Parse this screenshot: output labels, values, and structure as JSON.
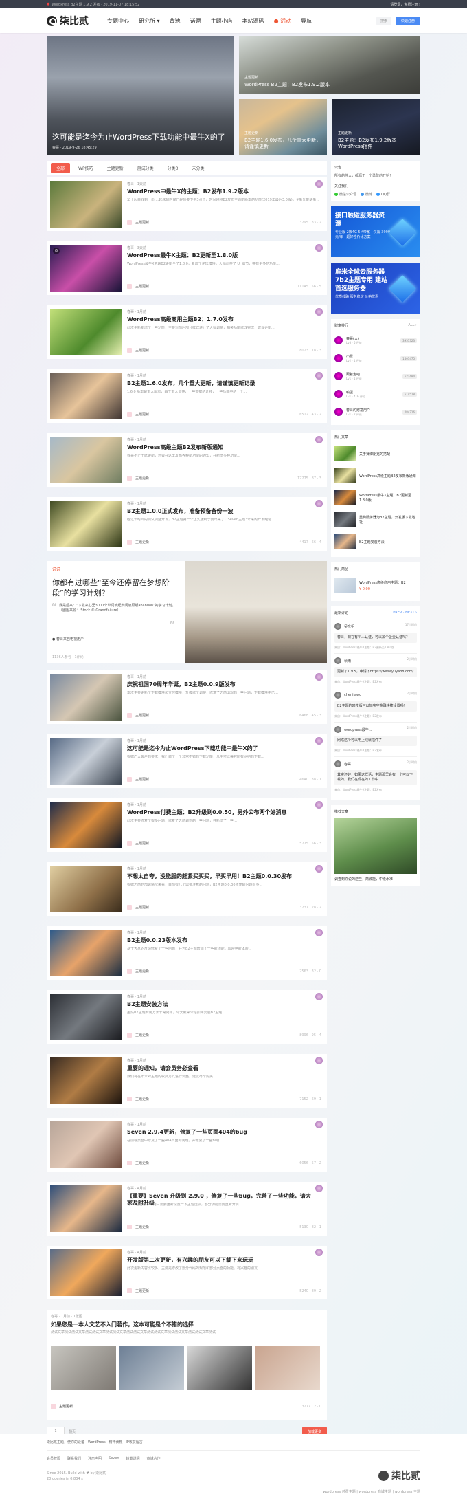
{
  "topbar": {
    "left": "WordPress B2主题 1.9.2 发布 · 2019-11-07 18:15:52",
    "right": "请登录，免费注册 ›"
  },
  "nav": {
    "logo": "柒比贰",
    "menu": [
      "专题中心",
      "研究所 ▾",
      "背池",
      "话题",
      "主题小店",
      "本站源码",
      "● 活动",
      "导航"
    ],
    "search": "搜索",
    "register": "快速注册"
  },
  "hero": {
    "big": {
      "tag": "● 未分类",
      "title": "这可能是迄今为止WordPress下载功能中最牛X的了",
      "meta": "春哥 · 2019-9-26 18:45:29"
    },
    "b1": {
      "tag": "主题更新",
      "title": "WordPress B2主题：B2发布1.9.2版本"
    },
    "b2": {
      "tag": "主题更新",
      "title": "B2主题1.6.0发布，几个重大更新，请谨慎更新"
    },
    "b3": {
      "tag": "主题更新",
      "title": "B2主题：B2发布1.9.2版本 WordPress插件"
    }
  },
  "tabs": [
    "全部",
    "WP技巧",
    "主题更新",
    "测试分类",
    "分类3",
    "未分类"
  ],
  "posts": [
    {
      "meta": "春哥 · 1天前",
      "title": "WordPress中最牛X的主题：B2发布1.9.2版本",
      "ex": "早上起来收到一份....起床的时候已经快要下午3点了，时间刚刚B2发布主题新版本的功能(2019年最后3.0版)，全新功能更新...",
      "cat": "主题更新",
      "stats": "3295 · 33 · 2"
    },
    {
      "meta": "春哥 · 3天前",
      "title": "WordPress最牛X主题：B2更新至1.8.0版",
      "ex": "WordPress最牛X主题B2更新至了1.8.0，新增了论坛模块，大幅调整了 UI 细节，拥有更多的功能...",
      "cat": "主题更新",
      "stats": "11145 · 56 · 5"
    },
    {
      "meta": "春哥 · 1月前",
      "title": "WordPress高级商用主题B2：1.7.0发布",
      "ex": "此次更新新增了一些功能，主要对前后部分样式进行了大幅调整，相关功能修改完成，建议更新...",
      "cat": "主题更新",
      "stats": "8023 · 78 · 3"
    },
    {
      "meta": "春哥 · 1月前",
      "title": "B2主题1.6.0发布，几个重大更新，请谨慎更新记录",
      "ex": "1.6.0 版本是重大版本，由于重大调整，一些数据的迁移，一些功能中的一个...",
      "cat": "主题更新",
      "stats": "6512 · 43 · 2"
    },
    {
      "meta": "春哥 · 1月前",
      "title": "WordPress高级主题B2发布新版通知",
      "ex": "春哥不止于此更新，还会在这里发布各种新功能的通知，并新增多种功能...",
      "cat": "主题更新",
      "stats": "12275 · 87 · 3"
    },
    {
      "meta": "春哥 · 1月前",
      "title": "B2主题1.0.0正式发布，准备预备备份一波",
      "ex": "经过长时间的测试调整开发，B2主题第一个正式版终于要出来了，Seven主题3年来的开发经验...",
      "cat": "主题更新",
      "stats": "4417 · 66 · 4"
    }
  ],
  "quote": {
    "label": "说说",
    "q": "你都有过哪些“至今还停留在梦想阶段”的学习计划？",
    "body": "我是后来：“下载来心里3000个单词就起步阅读原版abandon”的学习计划。（图图来源：iStock © Grandfailure）",
    "author": "● 春哥来自电视用户",
    "ft": "1136人参与 · 1评论"
  },
  "posts2": [
    {
      "meta": "春哥 · 1月前",
      "title": "庆祝祖国70周年华诞，B2主题0.0.9版发布",
      "ex": "本次主要更新了下载模块和支付模块，升级修了调整，修复了之前出现的一些问题，下载模块中已…",
      "cat": "主题更新",
      "stats": "6468 · 45 · 3"
    },
    {
      "meta": "春哥 · 1月前",
      "title": "这可能是迄今为止WordPress下载功能中最牛X的了",
      "ex": "根据广大客户的要求，我们做了一个非常不错的下载功能，几乎可以兼容所有网络的下载...",
      "cat": "主题更新",
      "stats": "4640 · 38 · 1"
    },
    {
      "meta": "春哥 · 1月前",
      "title": "WordPress付费主题：B2升级到0.0.50，另外公布两个好消息",
      "ex": "此次主要修复了很多问题，修复了之前遇到的一些问题，并新增了一些…",
      "cat": "主题更新",
      "stats": "5775 · 56 · 3"
    },
    {
      "meta": "春哥 · 1月前",
      "title": "不想太自夸，没能服的赶紧买买买，早买早用！B2主题0.0.30发布",
      "ex": "根据之前的加速情况来看，目前有几个需要注意的问题，B2主题0.0.30修复的问题很多...",
      "cat": "主题更新",
      "stats": "3237 · 28 · 2"
    },
    {
      "meta": "春哥 · 1月前",
      "title": "B2主题0.0.23版本发布",
      "ex": "基于大家的反馈修复了一些问题，并为B2主题增加了一些新功能，欢迎更新体验...",
      "cat": "主题更新",
      "stats": "2563 · 32 · 0"
    },
    {
      "meta": "春哥 · 1月前",
      "title": "B2主题安装方法",
      "ex": "虽然B2主题安装方法非常简单，今天就来介绍如何安装B2主题...",
      "cat": "主题更新",
      "stats": "8996 · 95 · 4"
    },
    {
      "meta": "春哥 · 1月前",
      "title": "重要的通知，请会员务必查看",
      "ex": "我们将在年末对主题的收费方式进行调整，建议尽早购买...",
      "cat": "主题更新",
      "stats": "7152 · 69 · 1"
    },
    {
      "meta": "春哥 · 1月前",
      "title": "Seven 2.9.4更新，修复了一些页面404的bug",
      "ex": "在前端页面中修复了一些404页面的问题，并修复了一些bug…",
      "cat": "主题更新",
      "stats": "6056 · 57 · 2"
    },
    {
      "meta": "春哥 · 4月前",
      "title": "【重要】Seven 升级到 2.9.0 ，修复了一些bug，完善了一些功能，请大家及时升级",
      "ex": "2.9.0之前版本的用户需要重新设置一下主题选项，部分功能需要重新开启...",
      "cat": "主题更新",
      "stats": "5130 · 82 · 1"
    },
    {
      "meta": "春哥 · 4月前",
      "title": "开发版第二次更新，有兴趣的朋友可以下载下来玩玩",
      "ex": "此次更新内容比较多，主要是修改了部分代码的规范和部分页面的功能，有兴趣的朋友...",
      "cat": "主题更新",
      "stats": "5240 · 89 · 2"
    }
  ],
  "gallery": {
    "meta": "春哥 · 1月前 · 1张图",
    "title": "如果您是一本人文艺不入门著作，这本可能是个不错的选择",
    "ex": "测试文章测试测试文章测试测试文章测试测试文章测试测试文章测试测试文章测试测试文章测试测试文章测试",
    "cat": "主题更新",
    "stats": "3277 · 2 · 0"
  },
  "pager": {
    "input": "1",
    "label": "翻页",
    "more": "加载更多"
  },
  "side": {
    "notice": {
      "title": "公告",
      "text": "所有的伟大，都源于一个勇敢的开始！"
    },
    "follow": {
      "title": "关注我们",
      "items": [
        "微信公众号",
        "微博",
        "QQ群"
      ]
    },
    "ad1": {
      "t1": "接口触碰服务器资源",
      "t2": "专业版 2核4G 5M带宽 · 仅需 3999元/年 · 超好性价比方案"
    },
    "ad2": {
      "t1": "雇米全球云服务器 7b2主题专用 建站首选服务器",
      "t2": "优质线路 服务稳定 价格优惠"
    },
    "rank": {
      "title": "财富排行",
      "more": "ALL ›",
      "items": [
        {
          "name": "春哥(大)",
          "sub": "Lv3 · 5 评论",
          "badge": "3951323"
        },
        {
          "name": "小雪",
          "sub": "Lv2 · 1 评论",
          "badge": "1501475"
        },
        {
          "name": "跟着走吧",
          "sub": "Lv1 · 1 评论",
          "badge": "621484"
        },
        {
          "name": "鸭蛋",
          "sub": "Lv1 · 416 评论",
          "badge": "514518"
        },
        {
          "name": "春哥的财富用户",
          "sub": "Lv1 · 2 评论",
          "badge": "284716"
        }
      ]
    },
    "hot": {
      "title": "热门文章",
      "items": [
        "关于赛博朋克的搭配",
        "WordPress高级主题B2发布新版通知",
        "WordPress最牛X主题：B2更新至1.8.0版",
        "重构服务器为B2主题，开发版下载地址",
        "B2主题安装方法"
      ]
    },
    "shop": {
      "title": "热门商品",
      "name": "WordPress高级商用主题：B2",
      "price": "¥ 0.00"
    },
    "comments": {
      "title": "最新评论",
      "more": "PREV · NEXT ›",
      "items": [
        {
          "name": "吴彦祖",
          "time": "17小时前",
          "text": "春哥，现在有个人认证，可以加个企业认证吗？",
          "from": "来自：WordPress最牛X主题：B2更新至1.8.0版"
        },
        {
          "name": "秋雨",
          "time": "2小时前",
          "text": "更新了1.9.5，申请下https://www.yuyao8.com/",
          "from": "来自：WordPress最牛X主题：B2发布"
        },
        {
          "name": "chenjiawu",
          "time": "2小时前",
          "text": "B2主题的暗夜版可以加实字金融快捷设置吗？",
          "from": "来自：WordPress最牛X主题：B2发布"
        },
        {
          "name": "wordpress最牛...",
          "time": "2小时前",
          "text": "网络这个可以用上线就插件了",
          "from": "来自：WordPress最牛X主题：B2发布"
        },
        {
          "name": "春哥",
          "time": "2小时前",
          "text": "其实还好，如果这样话，主题那里会有一个可以下载的，我们在现在的工作中...",
          "from": "来自：WordPress最牛X主题：B2发布"
        }
      ]
    },
    "recent": {
      "title": "推荐文章",
      "cap": "调查到你说的这些，商城能，中级水准"
    }
  },
  "footer": {
    "row1": "柒比贰主题，使你的设备 · WordPress · 精神食粮 · IP收获留言",
    "links": [
      "会员权限",
      "联系我们",
      "注册声明",
      "Seven",
      "转载说明",
      "商城合作"
    ],
    "copy": "Since 2015. Build with ♥ by 柒比贰",
    "stat": "20 queries in 0.834 s",
    "logo": "柒比贰",
    "bottom": "wordpress 付费主题 | wordpress 商城主题 | wordpress 主题"
  }
}
